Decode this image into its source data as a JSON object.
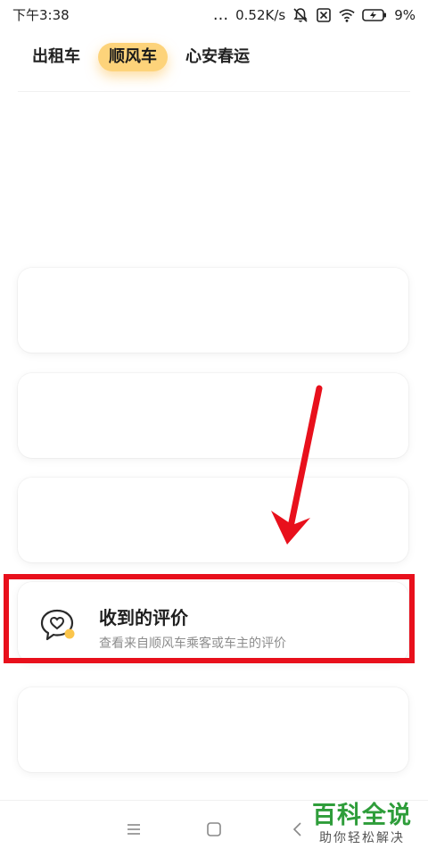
{
  "status_bar": {
    "time": "下午3:38",
    "dots": "...",
    "network_speed": "0.52K/s",
    "battery": "9%",
    "icons": [
      "mute-bell-icon",
      "sim-off-icon",
      "wifi-icon",
      "battery-charging-icon"
    ]
  },
  "tabs": [
    {
      "label": "出租车",
      "selected": false
    },
    {
      "label": "顺风车",
      "selected": true
    },
    {
      "label": "心安春运",
      "selected": false
    }
  ],
  "review_card": {
    "title": "收到的评价",
    "subtitle": "查看来自顺风车乘客或车主的评价",
    "icon": "chat-heart-icon"
  },
  "annotation": {
    "highlight_color": "#e8101c",
    "arrow_color": "#e8101c"
  },
  "bottom_nav": {
    "buttons": [
      "menu-icon",
      "home-icon",
      "back-icon"
    ]
  },
  "watermark": {
    "title": "百科全说",
    "subtitle": "助你轻松解决",
    "color": "#2e9d3a"
  },
  "colors": {
    "accent": "#fdd37a",
    "text_primary": "#1f1f1f",
    "text_secondary": "#8c8c8c"
  }
}
